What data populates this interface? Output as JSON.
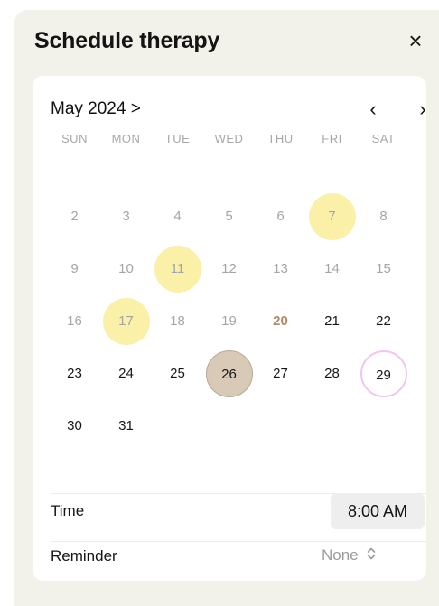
{
  "header": {
    "title": "Schedule therapy",
    "close_icon": "×"
  },
  "calendar": {
    "month_label": "May 2024 >",
    "prev_icon": "‹",
    "next_icon": "›",
    "weekdays": [
      "SUN",
      "MON",
      "TUE",
      "WED",
      "THU",
      "FRI",
      "SAT"
    ],
    "weeks": [
      [
        {
          "d": "",
          "s": "empty"
        },
        {
          "d": "",
          "s": "empty"
        },
        {
          "d": "",
          "s": "empty"
        },
        {
          "d": "",
          "s": "empty"
        },
        {
          "d": "",
          "s": "empty"
        },
        {
          "d": "",
          "s": "empty"
        },
        {
          "d": "",
          "s": "empty"
        }
      ],
      [
        {
          "d": "2",
          "s": "muted"
        },
        {
          "d": "3",
          "s": "muted"
        },
        {
          "d": "4",
          "s": "muted"
        },
        {
          "d": "5",
          "s": "muted"
        },
        {
          "d": "6",
          "s": "muted"
        },
        {
          "d": "7",
          "s": "muted hl"
        },
        {
          "d": "8",
          "s": "muted"
        }
      ],
      [
        {
          "d": "9",
          "s": "muted"
        },
        {
          "d": "10",
          "s": "muted"
        },
        {
          "d": "11",
          "s": "muted hl"
        },
        {
          "d": "12",
          "s": "muted"
        },
        {
          "d": "13",
          "s": "muted"
        },
        {
          "d": "14",
          "s": "muted"
        },
        {
          "d": "15",
          "s": "muted"
        }
      ],
      [
        {
          "d": "16",
          "s": "muted"
        },
        {
          "d": "17",
          "s": "muted hl"
        },
        {
          "d": "18",
          "s": "muted"
        },
        {
          "d": "19",
          "s": "muted"
        },
        {
          "d": "20",
          "s": "today"
        },
        {
          "d": "21",
          "s": "normal"
        },
        {
          "d": "22",
          "s": "normal"
        }
      ],
      [
        {
          "d": "23",
          "s": "normal"
        },
        {
          "d": "24",
          "s": "normal"
        },
        {
          "d": "25",
          "s": "normal"
        },
        {
          "d": "26",
          "s": "selected"
        },
        {
          "d": "27",
          "s": "normal"
        },
        {
          "d": "28",
          "s": "normal"
        },
        {
          "d": "29",
          "s": "ring"
        }
      ],
      [
        {
          "d": "30",
          "s": "normal"
        },
        {
          "d": "31",
          "s": "normal"
        },
        {
          "d": "",
          "s": "empty"
        },
        {
          "d": "",
          "s": "empty"
        },
        {
          "d": "",
          "s": "empty"
        },
        {
          "d": "",
          "s": "empty"
        },
        {
          "d": "",
          "s": "empty"
        }
      ]
    ]
  },
  "time": {
    "label": "Time",
    "value": "8:00 AM"
  },
  "reminder": {
    "label": "Reminder",
    "value": "None",
    "icon": "updown-chevron-icon"
  },
  "colors": {
    "sheet_background": "#f3f2ea",
    "highlight_yellow": "#faf0a8",
    "selected_taupe": "#d9cab8",
    "today_text": "#b5876a",
    "ring_pink": "#efc6f0"
  }
}
